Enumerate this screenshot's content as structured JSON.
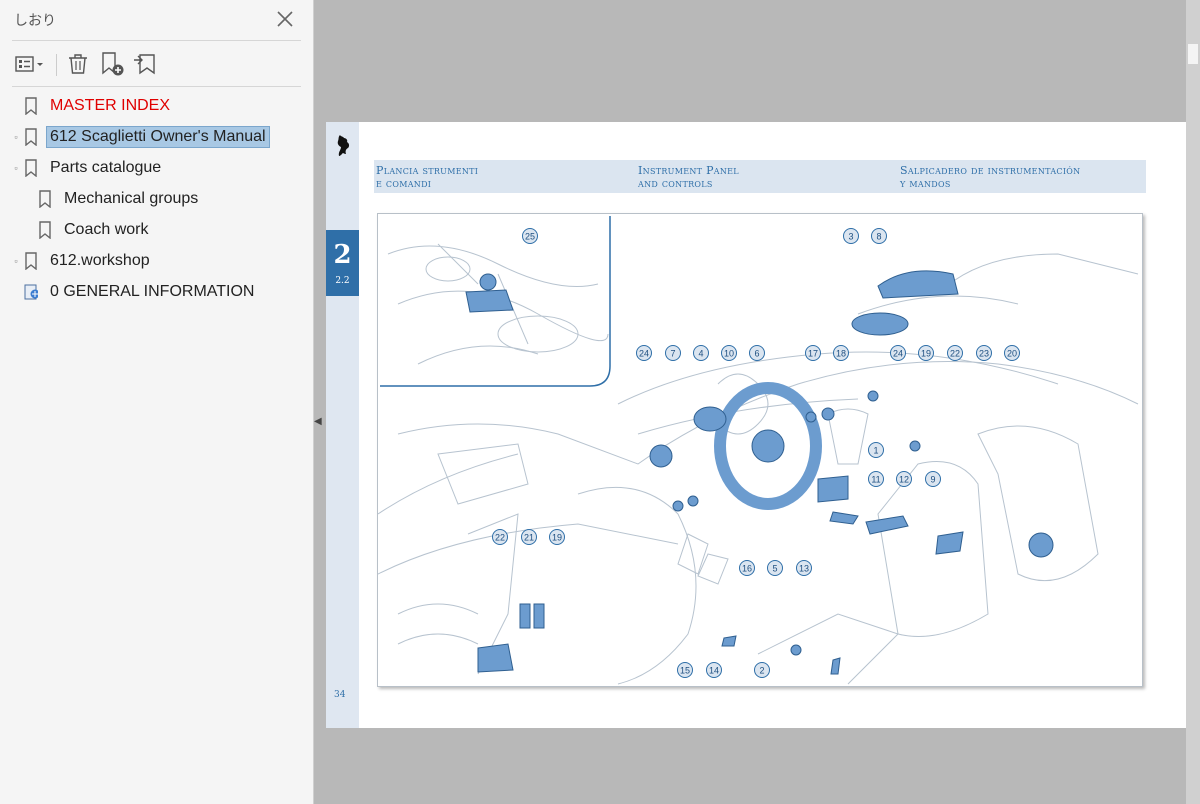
{
  "panel": {
    "title": "しおり",
    "close_icon": "close-icon",
    "toolbar": [
      {
        "name": "bookmark-options-button",
        "icon": "options-menu-icon"
      },
      {
        "name": "delete-bookmark-button",
        "icon": "trash-icon"
      },
      {
        "name": "new-bookmark-button",
        "icon": "bookmark-add-icon"
      },
      {
        "name": "find-current-bookmark-button",
        "icon": "bookmark-find-icon"
      }
    ],
    "bookmarks": [
      {
        "label": "MASTER INDEX",
        "color": "#e00000",
        "expandable": false,
        "selected": false,
        "level": 0
      },
      {
        "label": "612 Scaglietti Owner's Manual",
        "expandable": true,
        "selected": true,
        "level": 0
      },
      {
        "label": "Parts catalogue",
        "expandable": true,
        "selected": false,
        "level": 0
      },
      {
        "label": "Mechanical groups",
        "expandable": false,
        "selected": false,
        "level": 1
      },
      {
        "label": "Coach work",
        "expandable": false,
        "selected": false,
        "level": 1
      },
      {
        "label": "612.workshop",
        "expandable": true,
        "selected": false,
        "level": 0
      },
      {
        "label": "0 GENERAL INFORMATION",
        "expandable": false,
        "selected": false,
        "level": 0,
        "icon": "document-link-icon"
      }
    ]
  },
  "document": {
    "chapter_number": "2",
    "chapter_section": "2.2",
    "page_number": "34",
    "header": {
      "italian_line1": "Plancia strumenti",
      "italian_line2": "e comandi",
      "english_line1": "Instrument Panel",
      "english_line2": "and controls",
      "spanish_line1": "Salpicadero de instrumentación",
      "spanish_line2": "y mandos"
    },
    "callouts": [
      "25",
      "3",
      "8",
      "24",
      "7",
      "4",
      "10",
      "6",
      "17",
      "18",
      "24",
      "19",
      "22",
      "23",
      "20",
      "1",
      "11",
      "12",
      "9",
      "16",
      "5",
      "13",
      "22",
      "21",
      "19",
      "15",
      "14",
      "2"
    ],
    "accent_color": "#2f6fa8",
    "highlight_color": "#6c9ccf"
  }
}
